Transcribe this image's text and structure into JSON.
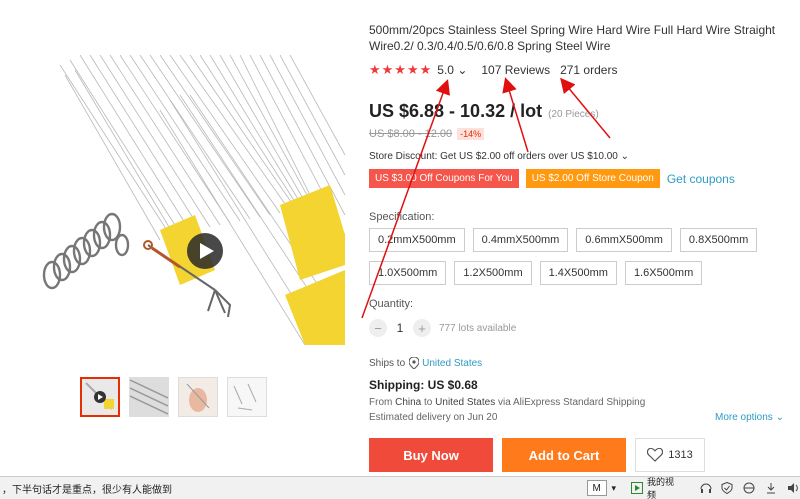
{
  "product": {
    "title": "500mm/20pcs Stainless Steel Spring Wire Hard Wire Full Hard Wire Straight Wire0.2/ 0.3/0.4/0.5/0.6/0.8 Spring Steel Wire",
    "stars": "★★★★★",
    "rating": "5.0",
    "rating_caret": "⌄",
    "reviews": "107 Reviews",
    "orders": "271 orders",
    "price": "US $6.88 - 10.32 / lot",
    "price_unit": "(20 Pieces)",
    "old_price": "US $8.00 - 12.00",
    "discount": "-14%",
    "store_discount": "Store Discount: Get US $2.00 off orders over US $10.00 ⌄",
    "coupon_red": "US $3.00 Off Coupons For You",
    "coupon_orange": "US $2.00 Off Store Coupon",
    "get_coupons": "Get coupons",
    "spec_label": "Specification:",
    "specs_row1": [
      "0.2mmX500mm",
      "0.4mmX500mm",
      "0.6mmX500mm",
      "0.8X500mm"
    ],
    "specs_row2": [
      "1.0X500mm",
      "1.2X500mm",
      "1.4X500mm",
      "1.6X500mm"
    ],
    "quantity_label": "Quantity:",
    "quantity": "1",
    "lots_available": "777 lots available",
    "ships_to_label": "Ships to",
    "ships_to": "United States",
    "shipping": "Shipping: US $0.68",
    "ship_from_pre": "From ",
    "ship_from_country": "China",
    "ship_from_mid": " to ",
    "ship_to_country": "United States",
    "ship_via": " via AliExpress Standard Shipping",
    "delivery": "Estimated delivery on Jun 20",
    "more_options": "More options ⌄",
    "buy_now": "Buy Now",
    "add_to_cart": "Add to Cart",
    "wishlist_count": "1313"
  },
  "bottombar": {
    "ticker": "，下半句话才是重点，很少有人能做到",
    "ime": "M",
    "video_label": "我的视频"
  },
  "colors": {
    "accent_red": "#f04a3a",
    "accent_orange": "#ff7a1a",
    "link_blue": "#2e9cc3",
    "arrow_red": "#e01010"
  }
}
